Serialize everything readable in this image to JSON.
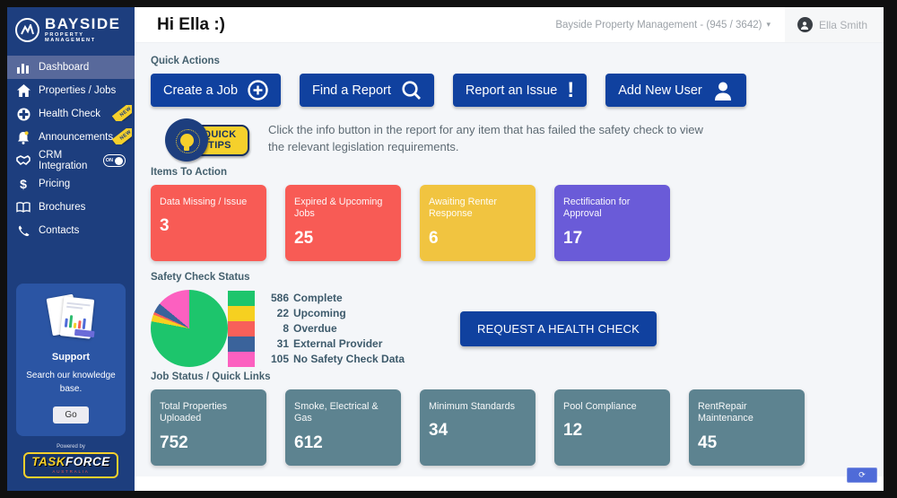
{
  "sidebar": {
    "logo": {
      "title": "BAYSIDE",
      "subtitle": "PROPERTY MANAGEMENT"
    },
    "items": [
      {
        "label": "Dashboard",
        "icon": "bar-chart-icon"
      },
      {
        "label": "Properties / Jobs",
        "icon": "home-icon"
      },
      {
        "label": "Health Check",
        "icon": "health-cross-icon",
        "badge": "NEW"
      },
      {
        "label": "Announcements",
        "icon": "bell-icon",
        "badge": "NEW"
      },
      {
        "label": "CRM Integration",
        "icon": "handshake-icon",
        "toggle": "ON"
      },
      {
        "label": "Pricing",
        "icon": "dollar-icon"
      },
      {
        "label": "Brochures",
        "icon": "book-icon"
      },
      {
        "label": "Contacts",
        "icon": "phone-icon"
      }
    ],
    "support": {
      "title": "Support",
      "text": "Search our knowledge base.",
      "button_label": "Go"
    },
    "powered_by": "Powered by",
    "taskforce": {
      "part1": "TASK",
      "part2": "FORCE",
      "subtext": "AUSTRALIA"
    }
  },
  "header": {
    "greeting": "Hi Ella :)",
    "account_selector": "Bayside Property Management - (945 / 3642)",
    "user_name": "Ella Smith"
  },
  "quick_actions": {
    "title": "Quick Actions",
    "buttons": [
      {
        "label": "Create a Job",
        "icon": "plus-circle-icon"
      },
      {
        "label": "Find a Report",
        "icon": "search-icon"
      },
      {
        "label": "Report an Issue",
        "icon": "exclamation-icon"
      },
      {
        "label": "Add New User",
        "icon": "add-user-icon"
      }
    ]
  },
  "quick_tips": {
    "badge_line1": "QUICK",
    "badge_line2": "TIPS",
    "text": "Click the info button in the report for any item that has failed the safety check to view the relevant legislation requirements."
  },
  "items_to_action": {
    "title": "Items To Action",
    "cards": [
      {
        "label": "Data Missing / Issue",
        "value": "3",
        "color": "#f85b55"
      },
      {
        "label": "Expired & Upcoming Jobs",
        "value": "25",
        "color": "#f85b55"
      },
      {
        "label": "Awaiting Renter Response",
        "value": "6",
        "color": "#f1c440"
      },
      {
        "label": "Rectification for Approval",
        "value": "17",
        "color": "#6a5bd8"
      }
    ]
  },
  "safety_check": {
    "title": "Safety Check Status",
    "request_button_label": "REQUEST A HEALTH CHECK"
  },
  "chart_data": {
    "type": "pie",
    "title": "Safety Check Status",
    "labels": [
      "Complete",
      "Upcoming",
      "Overdue",
      "External Provider",
      "No Safety Check Data"
    ],
    "values": [
      586,
      22,
      8,
      31,
      105
    ],
    "colors": [
      "#1dc56c",
      "#f6d020",
      "#f8605a",
      "#3a639b",
      "#fc60c0"
    ],
    "legend_position": "right"
  },
  "job_status": {
    "title": "Job Status / Quick Links",
    "card_color": "#5d8390",
    "cards": [
      {
        "label": "Total Properties Uploaded",
        "value": "752"
      },
      {
        "label": "Smoke, Electrical & Gas",
        "value": "612"
      },
      {
        "label": "Minimum Standards",
        "value": "34"
      },
      {
        "label": "Pool Compliance",
        "value": "12"
      },
      {
        "label": "RentRepair Maintenance",
        "value": "45"
      }
    ]
  }
}
